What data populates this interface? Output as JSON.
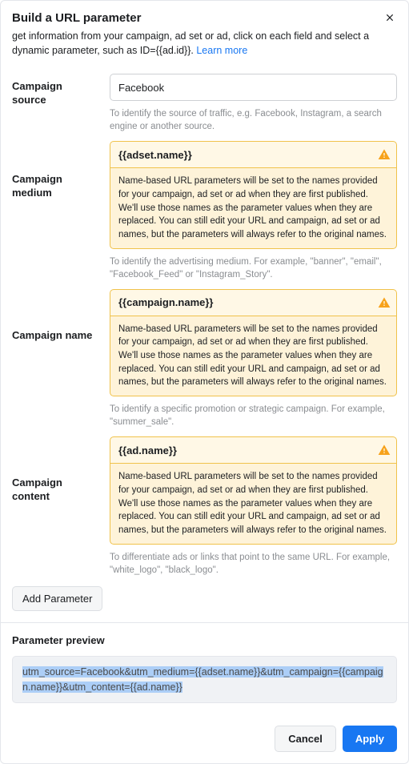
{
  "header": {
    "title": "Build a URL parameter"
  },
  "intro": {
    "text": "get information from your campaign, ad set or ad, click on each field and select a dynamic parameter, such as ID={{ad.id}}. ",
    "link": "Learn more"
  },
  "fields": {
    "source": {
      "label": "Campaign source",
      "value": "Facebook",
      "helper": "To identify the source of traffic, e.g. Facebook, Instagram, a search engine or another source."
    },
    "medium": {
      "label": "Campaign medium",
      "value": "{{adset.name}}",
      "warn": "Name-based URL parameters will be set to the names provided for your campaign, ad set or ad when they are first published. We'll use those names as the parameter values when they are replaced. You can still edit your URL and campaign, ad set or ad names, but the parameters will always refer to the original names.",
      "helper": "To identify the advertising medium. For example, \"banner\", \"email\", \"Facebook_Feed\" or \"Instagram_Story\"."
    },
    "name": {
      "label": "Campaign name",
      "value": "{{campaign.name}}",
      "warn": "Name-based URL parameters will be set to the names provided for your campaign, ad set or ad when they are first published. We'll use those names as the parameter values when they are replaced. You can still edit your URL and campaign, ad set or ad names, but the parameters will always refer to the original names.",
      "helper": "To identify a specific promotion or strategic campaign. For example, \"summer_sale\"."
    },
    "content": {
      "label": "Campaign content",
      "value": "{{ad.name}}",
      "warn": "Name-based URL parameters will be set to the names provided for your campaign, ad set or ad when they are first published. We'll use those names as the parameter values when they are replaced. You can still edit your URL and campaign, ad set or ad names, but the parameters will always refer to the original names.",
      "helper": "To differentiate ads or links that point to the same URL. For example, \"white_logo\", \"black_logo\"."
    }
  },
  "add_parameter": "Add Parameter",
  "preview": {
    "title": "Parameter preview",
    "value": "utm_source=Facebook&utm_medium={{adset.name}}&utm_campaign={{campaign.name}}&utm_content={{ad.name}}"
  },
  "footer": {
    "cancel": "Cancel",
    "apply": "Apply"
  }
}
